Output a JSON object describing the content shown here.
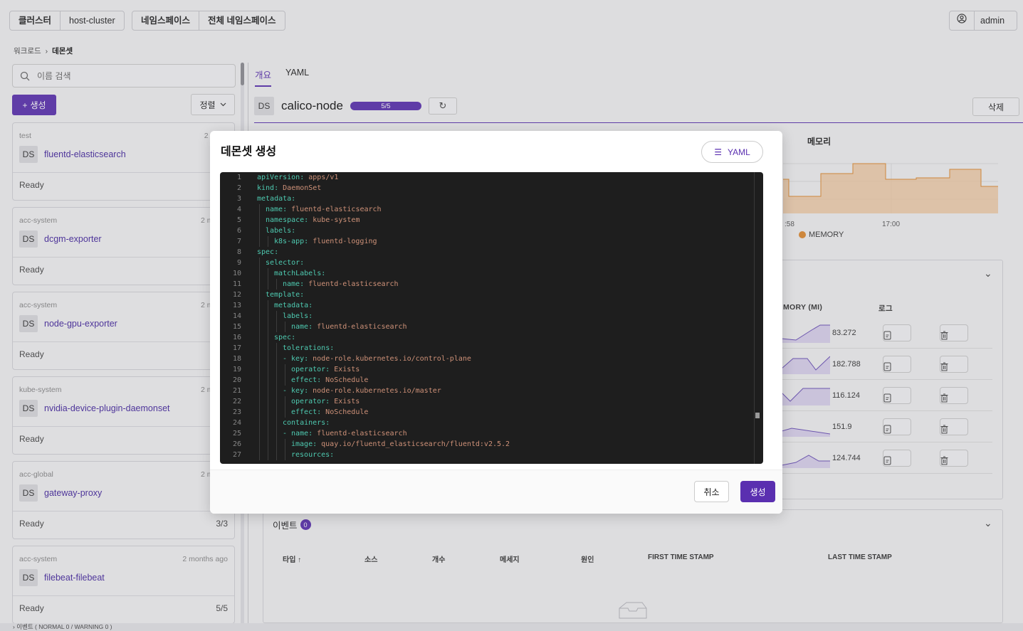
{
  "header": {
    "cluster_label": "클러스터",
    "cluster_value": "host-cluster",
    "namespace_label": "네임스페이스",
    "namespace_value": "전체 네임스페이스",
    "user": "admin"
  },
  "breadcrumb": {
    "parent": "워크로드",
    "current": "데몬셋"
  },
  "sidebar": {
    "search_placeholder": "이름 검색",
    "create_label": "생성",
    "sort_label": "정렬",
    "items": [
      {
        "namespace": "test",
        "age": "2 week",
        "badge": "DS",
        "name": "fluentd-elasticsearch",
        "status": "Ready",
        "count": ""
      },
      {
        "namespace": "acc-system",
        "age": "2 month",
        "badge": "DS",
        "name": "dcgm-exporter",
        "status": "Ready",
        "count": ""
      },
      {
        "namespace": "acc-system",
        "age": "2 month",
        "badge": "DS",
        "name": "node-gpu-exporter",
        "status": "Ready",
        "count": ""
      },
      {
        "namespace": "kube-system",
        "age": "2 month",
        "badge": "DS",
        "name": "nvidia-device-plugin-daemonset",
        "status": "Ready",
        "count": ""
      },
      {
        "namespace": "acc-global",
        "age": "2 month",
        "badge": "DS",
        "name": "gateway-proxy",
        "status": "Ready",
        "count": "3/3"
      },
      {
        "namespace": "acc-system",
        "age": "2 months ago",
        "badge": "DS",
        "name": "filebeat-filebeat",
        "status": "Ready",
        "count": "5/5"
      }
    ]
  },
  "detail": {
    "tabs": [
      "개요",
      "YAML"
    ],
    "badge": "DS",
    "title": "calico-node",
    "progress_text": "5/5",
    "delete_label": "삭제",
    "memory_title": "메모리",
    "ticks": [
      ":58",
      "17:00"
    ],
    "legend": "MEMORY",
    "col_memory": "MORY (MI)",
    "col_log": "로그",
    "pod_values": [
      "83.272",
      "182.788",
      "116.124",
      "151.9",
      "124.744"
    ]
  },
  "events": {
    "title": "이벤트",
    "count": "0",
    "columns": [
      "타입 ↑",
      "소스",
      "개수",
      "메세지",
      "원인",
      "FIRST TIME STAMP",
      "LAST TIME STAMP"
    ]
  },
  "bottom_bar": "이벤트 ( NORMAL 0 / WARNING 0 )",
  "modal": {
    "title": "데몬셋 생성",
    "yaml_label": "YAML",
    "cancel_label": "취소",
    "submit_label": "생성",
    "code": [
      {
        "n": "1",
        "i": 0,
        "k": "apiVersion:",
        "v": " apps/v1"
      },
      {
        "n": "2",
        "i": 0,
        "k": "kind:",
        "v": " DaemonSet"
      },
      {
        "n": "3",
        "i": 0,
        "k": "metadata:",
        "v": ""
      },
      {
        "n": "4",
        "i": 1,
        "k": "name:",
        "v": " fluentd-elasticsearch"
      },
      {
        "n": "5",
        "i": 1,
        "k": "namespace:",
        "v": " kube-system"
      },
      {
        "n": "6",
        "i": 1,
        "k": "labels:",
        "v": ""
      },
      {
        "n": "7",
        "i": 2,
        "k": "k8s-app:",
        "v": " fluentd-logging"
      },
      {
        "n": "8",
        "i": 0,
        "k": "spec:",
        "v": ""
      },
      {
        "n": "9",
        "i": 1,
        "k": "selector:",
        "v": ""
      },
      {
        "n": "10",
        "i": 2,
        "k": "matchLabels:",
        "v": ""
      },
      {
        "n": "11",
        "i": 3,
        "k": "name:",
        "v": " fluentd-elasticsearch"
      },
      {
        "n": "12",
        "i": 1,
        "k": "template:",
        "v": ""
      },
      {
        "n": "13",
        "i": 2,
        "k": "metadata:",
        "v": ""
      },
      {
        "n": "14",
        "i": 3,
        "k": "labels:",
        "v": ""
      },
      {
        "n": "15",
        "i": 4,
        "k": "name:",
        "v": " fluentd-elasticsearch"
      },
      {
        "n": "16",
        "i": 2,
        "k": "spec:",
        "v": ""
      },
      {
        "n": "17",
        "i": 3,
        "k": "tolerations:",
        "v": ""
      },
      {
        "n": "18",
        "i": 3,
        "k": "- key:",
        "v": " node-role.kubernetes.io/control-plane"
      },
      {
        "n": "19",
        "i": 4,
        "k": "operator:",
        "v": " Exists"
      },
      {
        "n": "20",
        "i": 4,
        "k": "effect:",
        "v": " NoSchedule"
      },
      {
        "n": "21",
        "i": 3,
        "k": "- key:",
        "v": " node-role.kubernetes.io/master"
      },
      {
        "n": "22",
        "i": 4,
        "k": "operator:",
        "v": " Exists"
      },
      {
        "n": "23",
        "i": 4,
        "k": "effect:",
        "v": " NoSchedule"
      },
      {
        "n": "24",
        "i": 3,
        "k": "containers:",
        "v": ""
      },
      {
        "n": "25",
        "i": 3,
        "k": "- name:",
        "v": " fluentd-elasticsearch"
      },
      {
        "n": "26",
        "i": 4,
        "k": "image:",
        "v": " quay.io/fluentd_elasticsearch/fluentd:v2.5.2"
      },
      {
        "n": "27",
        "i": 4,
        "k": "resources:",
        "v": ""
      }
    ]
  },
  "colors": {
    "accent": "#5a2fb0",
    "memory": "#e08a2f",
    "editor_bg": "#1e1e1e"
  }
}
